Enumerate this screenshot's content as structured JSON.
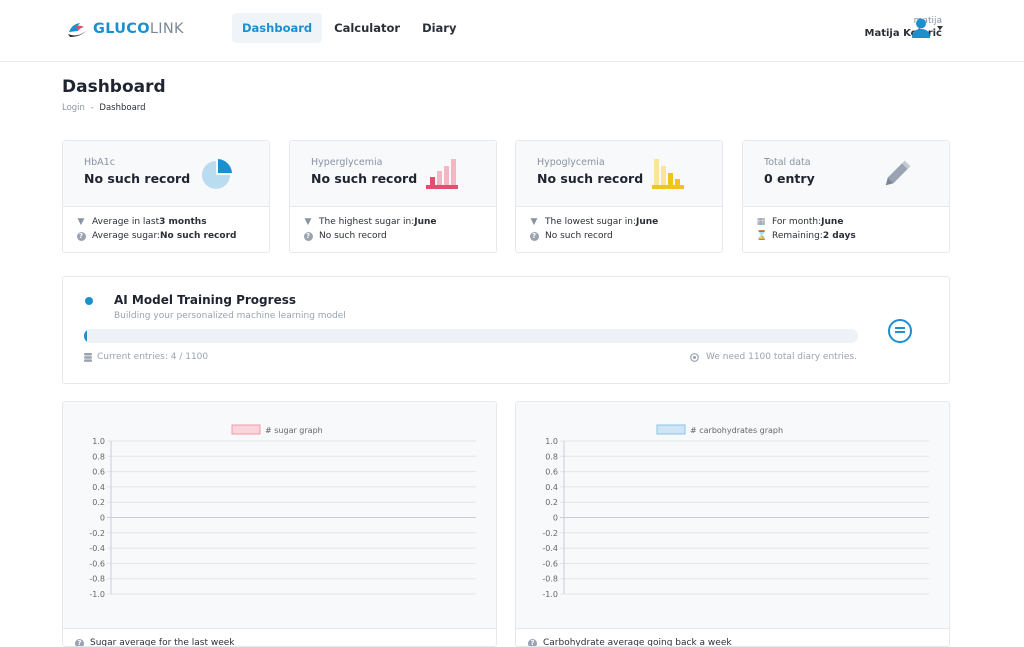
{
  "brand": {
    "part1": "GLUCO",
    "part2": "LINK"
  },
  "nav": [
    {
      "label": "Dashboard",
      "active": true
    },
    {
      "label": "Calculator",
      "active": false
    },
    {
      "label": "Diary",
      "active": false
    }
  ],
  "user": {
    "username": "matija",
    "fullname": "Matija Kolarić"
  },
  "page": {
    "title": "Dashboard"
  },
  "breadcrumb": {
    "home": "Login",
    "separator": "-",
    "current": "Dashboard"
  },
  "cards": [
    {
      "label": "HbA1c",
      "value": "No such record",
      "icon": "pie-chart-icon",
      "color": "#1c8fcf",
      "line1_prefix": "Average in last ",
      "line1_bold": "3 months",
      "line2_prefix": "Average sugar: ",
      "line2_bold": "No such record"
    },
    {
      "label": "Hyperglycemia",
      "value": "No such record",
      "icon": "bar-chart-up-icon",
      "color": "#e0506e",
      "line1_prefix": "The highest sugar in: ",
      "line1_bold": "June",
      "line2_prefix": "No such record",
      "line2_bold": ""
    },
    {
      "label": "Hypoglycemia",
      "value": "No such record",
      "icon": "bar-chart-down-icon",
      "color": "#f2c318",
      "line1_prefix": "The lowest sugar in: ",
      "line1_bold": "June",
      "line2_prefix": "No such record",
      "line2_bold": ""
    },
    {
      "label": "Total data",
      "value": "0 entry",
      "icon": "pencil-icon",
      "color": "#8a93a3",
      "line1_prefix": "For month: ",
      "line1_bold": "June",
      "line2_prefix": "Remaining: ",
      "line2_bold": "2 days"
    }
  ],
  "training": {
    "title": "AI Model Training Progress",
    "subtitle": "Building your personalized machine learning model",
    "entries_text": "Current entries: 4 / 1100",
    "need_text": "We need 1100 total diary entries.",
    "progress": 0.0036
  },
  "charts": [
    {
      "legend": "# sugar graph",
      "footer": "Sugar average for the last week",
      "color_fill": "#fbd5dc",
      "color_border": "#ee9aaa",
      "chart_data": {
        "type": "line",
        "series": [
          {
            "name": "# sugar graph",
            "values": []
          }
        ],
        "y_ticks": [
          "1.0",
          "0.8",
          "0.6",
          "0.4",
          "0.2",
          "0",
          "-0.2",
          "-0.4",
          "-0.6",
          "-0.8",
          "-1.0"
        ],
        "ylim": [
          -1.0,
          1.0
        ]
      }
    },
    {
      "legend": "# carbohydrates graph",
      "footer": "Carbohydrate average going back a week",
      "color_fill": "#cfe5f6",
      "color_border": "#8cc2e8",
      "chart_data": {
        "type": "line",
        "series": [
          {
            "name": "# carbohydrates graph",
            "values": []
          }
        ],
        "y_ticks": [
          "1.0",
          "0.8",
          "0.6",
          "0.4",
          "0.2",
          "0",
          "-0.2",
          "-0.4",
          "-0.6",
          "-0.8",
          "-1.0"
        ],
        "ylim": [
          -1.0,
          1.0
        ]
      }
    }
  ]
}
